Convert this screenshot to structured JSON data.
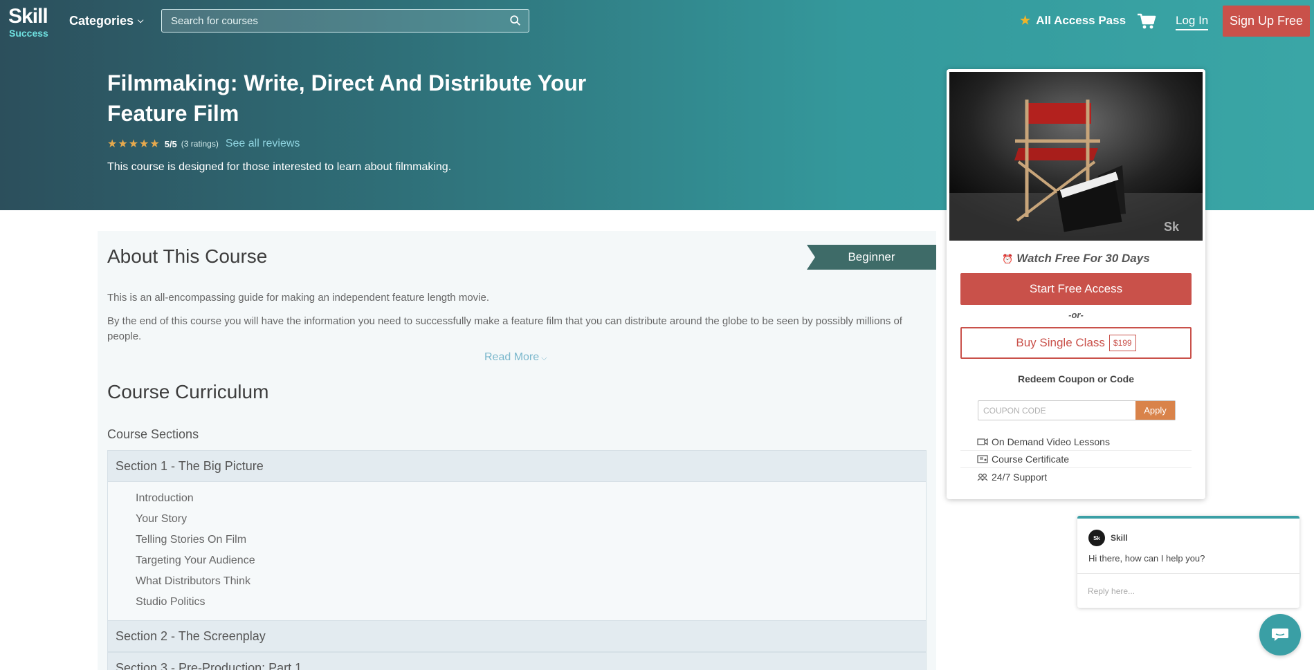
{
  "brand": {
    "line1": "Skill",
    "line2": "Success",
    "accent": "#3a9fa5",
    "cta": "#c9514a"
  },
  "nav": {
    "categories": "Categories",
    "search_placeholder": "Search for courses",
    "all_access": "All Access Pass",
    "login": "Log In",
    "signup": "Sign Up Free"
  },
  "course": {
    "title": "Filmmaking: Write, Direct And Distribute Your Feature Film",
    "rating_stars": 5,
    "score": "5/5",
    "ratings_count": "(3 ratings)",
    "see_reviews": "See all reviews",
    "description": "This course is designed for those interested to learn about filmmaking."
  },
  "about": {
    "title": "About This Course",
    "level": "Beginner",
    "p1": "This is an all-encompassing guide for making an independent feature length movie.",
    "p2": "By the end of this course you will have the information you need to successfully make a feature film that you can distribute around the globe to be seen by possibly millions of people.",
    "read_more": "Read More"
  },
  "curriculum": {
    "title": "Course Curriculum",
    "sections_label": "Course Sections",
    "sections": [
      {
        "title": "Section 1 - The Big Picture",
        "lessons": [
          "Introduction",
          "Your Story",
          "Telling Stories On Film",
          "Targeting Your Audience",
          "What Distributors Think",
          "Studio Politics"
        ]
      },
      {
        "title": "Section 2 - The Screenplay"
      },
      {
        "title": "Section 3 - Pre-Production: Part 1"
      }
    ]
  },
  "card": {
    "watch_free": "Watch Free For 30 Days",
    "start_free": "Start Free Access",
    "or": "-or-",
    "buy_single": "Buy Single Class",
    "price": "$199",
    "redeem": "Redeem Coupon or Code",
    "coupon_placeholder": "COUPON CODE",
    "apply": "Apply",
    "features": [
      "On Demand Video Lessons",
      "Course Certificate",
      "24/7 Support"
    ]
  },
  "chat": {
    "avatar_text": "Sk",
    "name": "Skill",
    "message": "Hi there, how can I help you?",
    "reply_placeholder": "Reply here..."
  }
}
